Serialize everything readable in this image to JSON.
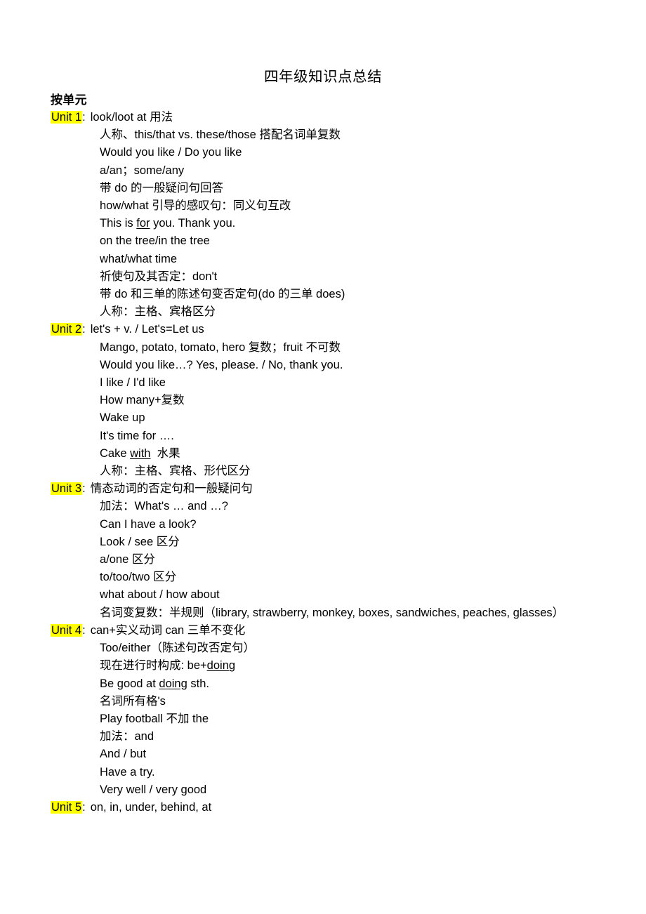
{
  "document": {
    "title": "四年级知识点总结",
    "section_heading": "按单元"
  },
  "units": [
    {
      "label": "Unit 1",
      "colon": ":",
      "lines": [
        "look/loot at 用法",
        "人称、this/that vs. these/those 搭配名词单复数",
        "Would you like / Do you like",
        "a/an；some/any",
        "带 do 的一般疑问句回答",
        "how/what 引导的感叹句：同义句互改",
        "This is for you. Thank you.",
        "on the tree/in the tree",
        "what/what time",
        "祈使句及其否定：don't",
        "带 do 和三单的陈述句变否定句(do 的三单 does)",
        "人称：主格、宾格区分"
      ]
    },
    {
      "label": "Unit 2",
      "colon": ":",
      "lines": [
        "let's + v. / Let's=Let us",
        "Mango, potato, tomato, hero 复数；fruit 不可数",
        "Would you like…? Yes, please. / No, thank you.",
        "I like / I'd like",
        "How many+复数",
        "Wake up",
        "It's time for ….",
        "Cake with  水果",
        "人称：主格、宾格、形代区分"
      ]
    },
    {
      "label": "Unit 3",
      "colon": ":",
      "lines": [
        "情态动词的否定句和一般疑问句",
        "加法：What's … and …?",
        "Can I have a look?",
        "Look / see 区分",
        "a/one 区分",
        "to/too/two 区分",
        "what about / how about",
        "名词变复数：半规则（library, strawberry, monkey, boxes, sandwiches, peaches, glasses）"
      ]
    },
    {
      "label": "Unit 4",
      "colon": ":",
      "lines": [
        "can+实义动词 can 三单不变化",
        "Too/either（陈述句改否定句）",
        "现在进行时构成: be+doing",
        "Be good at doing sth.",
        "名词所有格's",
        "Play football 不加 the",
        "加法：and",
        "And / but",
        "Have a try.",
        "Very well / very good"
      ]
    },
    {
      "label": "Unit 5",
      "colon": ":",
      "lines": [
        "on, in, under, behind, at"
      ]
    }
  ],
  "styling": {
    "highlight_color": "#ffff00",
    "text_color": "#000000",
    "background_color": "#ffffff"
  },
  "underlined_words": [
    "for",
    "with",
    "doing",
    "doing"
  ]
}
